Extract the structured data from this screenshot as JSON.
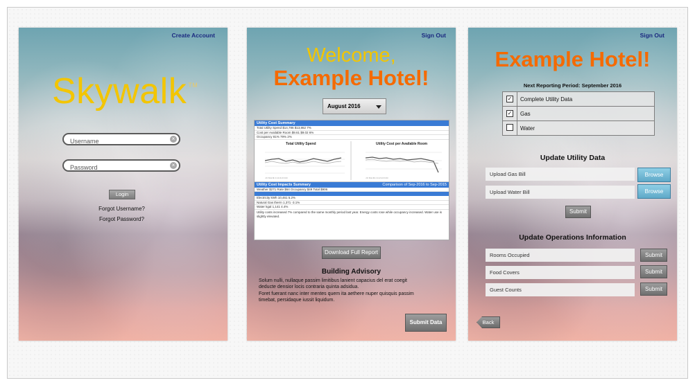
{
  "screen1": {
    "create_account": "Create Account",
    "brand": "Skywalk",
    "brand_tm": "TM",
    "username_placeholder": "Username",
    "password_placeholder": "Password",
    "login_label": "Login",
    "forgot_username": "Forgot Username?",
    "forgot_password": "Forgot Password?"
  },
  "screen2": {
    "sign_out": "Sign Out",
    "welcome": "Welcome,",
    "hotel_name": "Example Hotel!",
    "month": "August 2016",
    "report": {
      "summary_title": "Utility Cost Summary",
      "chart1_title": "Total Utility Spend",
      "chart2_title": "Utility Cost per Available Room",
      "impacts_title": "Utility Cost Impacts Summary",
      "comparison": "Comparison of Sep-2016 to Sep-2015",
      "row1": "Total Utility Spend          $14,786     $13,862       7%",
      "row2": "Cost per Available Room        $9.61       $9.02       6%",
      "row3": "Occupancy                      81%          79%       2%",
      "irow1": "Weather   $271      Rate   $64      Occupancy   $49      Total   $906",
      "irow2": "Electricity      kWh      10,461     5.2%",
      "irow3": "Natural Gas      therm    1,371     -3.1%",
      "irow4": "Water            kgal     1,141      4.4%",
      "note": "Utility costs increased 7% compared to the same monthly period last year. Energy costs rose while occupancy increased. Water use is slightly elevated."
    },
    "download_label": "Download Full Report",
    "advisory_title": "Building Advisory",
    "advisory_p1": "Solum nulli, nullaque passim limitibus lanient capacius del erat coegit deducte densior locis contraria quinta adsidua.",
    "advisory_p2": "Foret fuerant nanc inter mentes quem ita aethere nuper quisquis passim timebat, persidaque iussit liquidum.",
    "submit_data": "Submit Data"
  },
  "screen3": {
    "sign_out": "Sign Out",
    "hotel_name": "Example Hotel!",
    "period": "Next Reporting Period:  September 2016",
    "checklist": [
      {
        "label": "Complete Utility Data",
        "checked": true
      },
      {
        "label": "Gas",
        "checked": true
      },
      {
        "label": "Water",
        "checked": false
      }
    ],
    "check_mark": "✓",
    "utility_title": "Update Utility Data",
    "upload_gas": "Upload Gas Bill",
    "upload_water": "Upload Water Bill",
    "browse": "Browse",
    "submit": "Submit",
    "ops_title": "Update Operations Information",
    "rooms": "Rooms Occupied",
    "food": "Food Covers",
    "guests": "Guest Counts",
    "back": "Back"
  }
}
